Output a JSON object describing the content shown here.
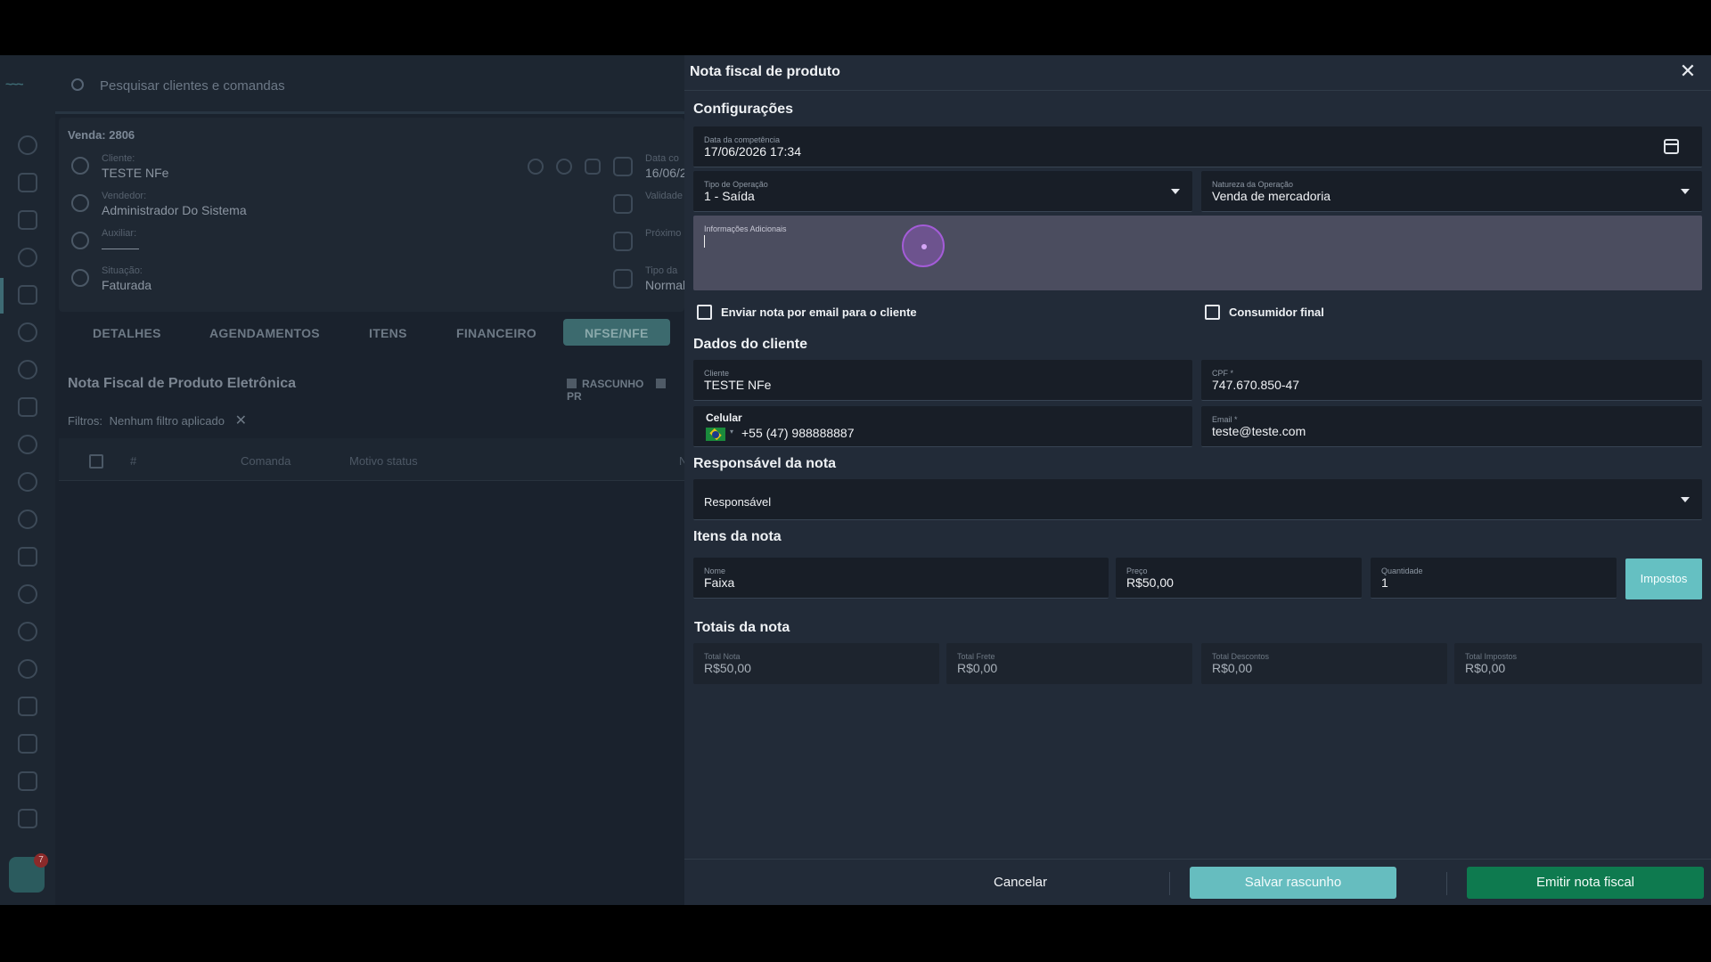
{
  "background": {
    "search_placeholder": "Pesquisar clientes e comandas",
    "sidebar_badge": "7",
    "venda": {
      "title": "Venda: 2806",
      "cliente_label": "Cliente:",
      "cliente_value": "TESTE NFe",
      "vendedor_label": "Vendedor:",
      "vendedor_value": "Administrador Do Sistema",
      "auxiliar_label": "Auxiliar:",
      "auxiliar_value": "———",
      "situacao_label": "Situação:",
      "situacao_value": "Faturada",
      "data_label": "Data co",
      "data_value": "16/06/2",
      "validade_label": "Validade",
      "proximo_label": "Próximo",
      "tipo_label": "Tipo da",
      "tipo_value": "Normal"
    },
    "tabs": [
      "DETALHES",
      "AGENDAMENTOS",
      "ITENS",
      "FINANCEIRO",
      "NFSE/NFE"
    ],
    "nfe_title": "Nota Fiscal de Produto Eletrônica",
    "legend": [
      "RASCUNHO",
      "PR"
    ],
    "filters_label": "Filtros:",
    "filters_value": "Nenhum filtro aplicado",
    "table_headers": [
      "#",
      "Comanda",
      "Motivo status",
      "N"
    ]
  },
  "modal": {
    "title": "Nota fiscal de produto",
    "config_section": "Configurações",
    "data_competencia": {
      "label": "Data da competência",
      "value": "17/06/2026 17:34"
    },
    "tipo_operacao": {
      "label": "Tipo de Operação",
      "value": "1 - Saída"
    },
    "natureza_operacao": {
      "label": "Natureza da Operação",
      "value": "Venda de mercadoria"
    },
    "info_adicionais": {
      "label": "Informações Adicionais",
      "value": ""
    },
    "enviar_email": {
      "label": "Enviar nota por email para o cliente",
      "checked": false
    },
    "consumidor_final": {
      "label": "Consumidor final",
      "checked": false
    },
    "cliente_section": "Dados do cliente",
    "cliente": {
      "label": "Cliente",
      "value": "TESTE NFe"
    },
    "cpf": {
      "label": "CPF *",
      "value": "747.670.850-47"
    },
    "celular": {
      "label": "Celular",
      "value": "+55 (47) 988888887"
    },
    "email": {
      "label": "Email *",
      "value": "teste@teste.com"
    },
    "responsavel_section": "Responsável da nota",
    "responsavel": {
      "value": "Responsável"
    },
    "itens_section": "Itens da nota",
    "item": {
      "nome_label": "Nome",
      "nome_value": "Faixa",
      "preco_label": "Preço",
      "preco_value": "R$50,00",
      "quantidade_label": "Quantidade",
      "quantidade_value": "1",
      "impostos_button": "Impostos"
    },
    "totais_section": "Totais da nota",
    "totais": [
      {
        "label": "Total Nota",
        "value": "R$50,00"
      },
      {
        "label": "Total Frete",
        "value": "R$0,00"
      },
      {
        "label": "Total Descontos",
        "value": "R$0,00"
      },
      {
        "label": "Total Impostos",
        "value": "R$0,00"
      }
    ],
    "footer": {
      "cancel": "Cancelar",
      "save_draft": "Salvar rascunho",
      "emit": "Emitir nota fiscal"
    }
  },
  "colors": {
    "modal_bg": "#222b38",
    "accent_teal": "#66bdbf",
    "emit_green": "#0e7a4f",
    "textarea_focus": "#4b4d5f"
  }
}
